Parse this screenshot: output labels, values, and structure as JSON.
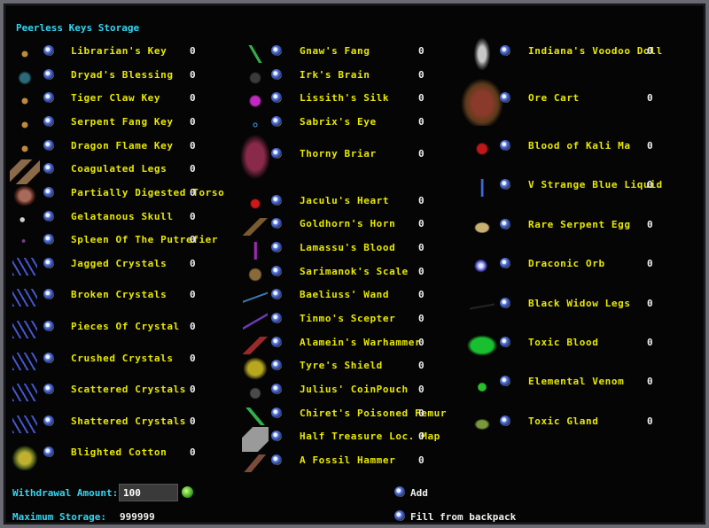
{
  "title": "Peerless Keys Storage",
  "columns": [
    [
      {
        "name": "Librarian's Key",
        "qty": "0",
        "icon": "key-icon"
      },
      {
        "name": "Dryad's Blessing",
        "qty": "0",
        "icon": "blessing-icon"
      },
      {
        "name": "Tiger Claw Key",
        "qty": "0",
        "icon": "key-icon"
      },
      {
        "name": "Serpent Fang Key",
        "qty": "0",
        "icon": "key-icon"
      },
      {
        "name": "Dragon Flame Key",
        "qty": "0",
        "icon": "key-icon"
      },
      {
        "name": "Coagulated Legs",
        "qty": "0",
        "icon": "legs-icon"
      },
      {
        "name": "Partially Digested Torso",
        "qty": "0",
        "icon": "torso-icon"
      },
      {
        "name": "Gelatanous Skull",
        "qty": "0",
        "icon": "skull-icon"
      },
      {
        "name": "Spleen Of The Putrefier",
        "qty": "0",
        "icon": "spleen-icon"
      },
      {
        "name": "Jagged Crystals",
        "qty": "0",
        "icon": "crystals-icon"
      },
      {
        "name": "Broken Crystals",
        "qty": "0",
        "icon": "crystals-icon"
      },
      {
        "name": "Pieces Of Crystal",
        "qty": "0",
        "icon": "crystals-icon"
      },
      {
        "name": "Crushed Crystals",
        "qty": "0",
        "icon": "crystals-icon"
      },
      {
        "name": "Scattered Crystals",
        "qty": "0",
        "icon": "crystals-icon"
      },
      {
        "name": "Shattered Crystals",
        "qty": "0",
        "icon": "crystals-icon"
      },
      {
        "name": "Blighted Cotton",
        "qty": "0",
        "icon": "cotton-icon"
      }
    ],
    [
      {
        "name": "Gnaw's Fang",
        "qty": "0",
        "icon": "fang-icon"
      },
      {
        "name": "Irk's Brain",
        "qty": "0",
        "icon": "brain-icon"
      },
      {
        "name": "Lissith's Silk",
        "qty": "0",
        "icon": "silk-icon"
      },
      {
        "name": "Sabrix's Eye",
        "qty": "0",
        "icon": "eye-icon"
      },
      {
        "name": "Thorny Briar",
        "qty": "0",
        "icon": "briar-icon"
      },
      {
        "name": "Jaculu's Heart",
        "qty": "0",
        "icon": "heart-icon"
      },
      {
        "name": "Goldhorn's Horn",
        "qty": "0",
        "icon": "horn-icon"
      },
      {
        "name": "Lamassu's Blood",
        "qty": "0",
        "icon": "blood-vial-icon"
      },
      {
        "name": "Sarimanok's Scale",
        "qty": "0",
        "icon": "scale-icon"
      },
      {
        "name": "Baeliuss' Wand",
        "qty": "0",
        "icon": "wand-icon"
      },
      {
        "name": "Tinmo's Scepter",
        "qty": "0",
        "icon": "scepter-icon"
      },
      {
        "name": "Alamein's Warhammer",
        "qty": "0",
        "icon": "warhammer-icon"
      },
      {
        "name": "Tyre's Shield",
        "qty": "0",
        "icon": "shield-icon"
      },
      {
        "name": "Julius' CoinPouch",
        "qty": "0",
        "icon": "coin-pouch-icon"
      },
      {
        "name": "Chiret's Poisoned Femur",
        "qty": "0",
        "icon": "femur-icon"
      },
      {
        "name": "Half Treasure Loc. Map",
        "qty": "0",
        "icon": "map-icon"
      },
      {
        "name": "A Fossil Hammer",
        "qty": "0",
        "icon": "hammer-icon"
      }
    ],
    [
      {
        "name": "Indiana's Voodoo Doll",
        "qty": "0",
        "icon": "voodoo-doll-icon"
      },
      {
        "name": "Ore Cart",
        "qty": "0",
        "icon": "ore-cart-icon"
      },
      {
        "name": "Blood of Kali Ma",
        "qty": "0",
        "icon": "blood-icon"
      },
      {
        "name": "V Strange Blue Liquid",
        "qty": "0",
        "icon": "blue-liquid-icon"
      },
      {
        "name": "Rare Serpent Egg",
        "qty": "0",
        "icon": "egg-icon"
      },
      {
        "name": "Draconic Orb",
        "qty": "0",
        "icon": "orb-icon"
      },
      {
        "name": "Black Widow Legs",
        "qty": "0",
        "icon": "spider-legs-icon"
      },
      {
        "name": "Toxic Blood",
        "qty": "0",
        "icon": "toxic-blood-icon"
      },
      {
        "name": "Elemental Venom",
        "qty": "0",
        "icon": "venom-flask-icon"
      },
      {
        "name": "Toxic Gland",
        "qty": "0",
        "icon": "gland-icon"
      }
    ]
  ],
  "footer": {
    "withdraw_label": "Withdrawal Amount:",
    "withdraw_value": "100",
    "max_label": "Maximum Storage:",
    "max_value": "999999",
    "add_label": "Add",
    "fill_label": "Fill from backpack"
  },
  "colors": {
    "label_cyan": "#33d6f2",
    "item_yellow": "#e8e800",
    "qty_white": "#f0f0f0"
  }
}
